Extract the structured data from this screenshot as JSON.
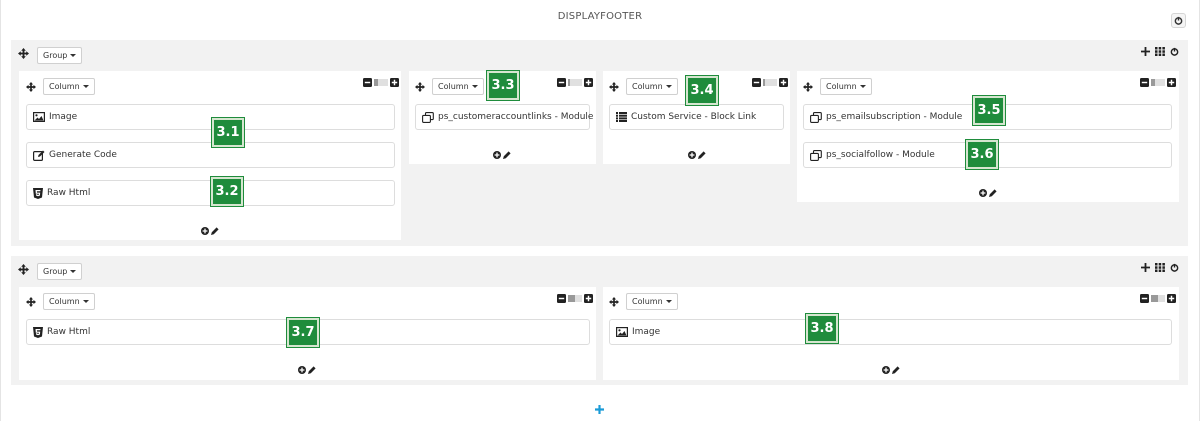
{
  "header": {
    "title": "DISPLAYFOOTER"
  },
  "group_label": "Group",
  "column_label": "Column",
  "groups": [
    {
      "columns": [
        {
          "modules": [
            {
              "icon": "image-icon",
              "label": "Image"
            },
            {
              "icon": "edit-icon",
              "label": "Generate Code"
            },
            {
              "icon": "html5-icon",
              "label": "Raw Html"
            }
          ]
        },
        {
          "modules": [
            {
              "icon": "module-icon",
              "label": "ps_customeraccountlinks - Module"
            }
          ]
        },
        {
          "modules": [
            {
              "icon": "list-icon",
              "label": "Custom Service - Block Link"
            }
          ]
        },
        {
          "modules": [
            {
              "icon": "module-icon",
              "label": "ps_emailsubscription - Module"
            },
            {
              "icon": "module-icon",
              "label": "ps_socialfollow - Module"
            }
          ]
        }
      ]
    },
    {
      "columns": [
        {
          "modules": [
            {
              "icon": "html5-icon",
              "label": "Raw Html"
            }
          ]
        },
        {
          "modules": [
            {
              "icon": "image-icon",
              "label": "Image"
            }
          ]
        }
      ]
    }
  ],
  "badges": [
    "3.1",
    "3.2",
    "3.3",
    "3.4",
    "3.5",
    "3.6",
    "3.7",
    "3.8"
  ],
  "colors": {
    "badge": "#1f8c3c",
    "add_blue": "#1a9bd7",
    "group_bg": "#f2f2f2"
  }
}
